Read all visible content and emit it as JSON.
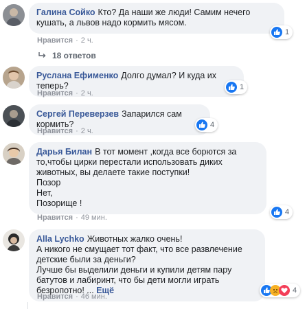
{
  "colors": {
    "author_link": "#385898",
    "bubble_bg": "#f0f2f5",
    "like_blue": "#1877f2",
    "meta_grey": "#90949c"
  },
  "comments": [
    {
      "author": "Галина Сойко",
      "text": "Кто? Да наши же люди! Самим нечего кушать, а львов надо кормить мясом.",
      "like_label": "Нравится",
      "time": "2 ч.",
      "reaction_icons": [
        "like-icon"
      ],
      "reaction_count": "1",
      "replies_label": "18 ответов"
    },
    {
      "author": "Руслана Ефименко",
      "text": "Долго думал? И куда их теперь?",
      "like_label": "Нравится",
      "time": "2 ч.",
      "reaction_icons": [
        "like-icon"
      ],
      "reaction_count": "1"
    },
    {
      "author": "Сергей Переверзев",
      "text": "Запарился сам кормить?",
      "like_label": "Нравится",
      "time": "2 ч.",
      "reaction_icons": [
        "like-icon"
      ],
      "reaction_count": "4"
    },
    {
      "author": "Дарья Билан",
      "text": "В тот момент ,когда все борются за то,чтобы цирки перестали использовать диких животных, вы делаете такие поступки!\nПозор\nНет,\nПозорище !",
      "like_label": "Нравится",
      "time": "49 мин.",
      "reaction_icons": [
        "like-icon"
      ],
      "reaction_count": "4"
    },
    {
      "author": "Alla Lychko",
      "text": "Животных жалко очень!\nА никого не смущает тот факт, что все развлечение детские были за деньги?\nЛучше бы выделили деньги и купили детям пару батутов и лабиринт, что бы дети могли играть безропотно! ...",
      "more_label": "Ещё",
      "like_label": "Нравится",
      "time": "46 мин.",
      "reaction_icons": [
        "like-icon",
        "sad-icon",
        "love-icon"
      ],
      "reaction_count": "4"
    }
  ]
}
